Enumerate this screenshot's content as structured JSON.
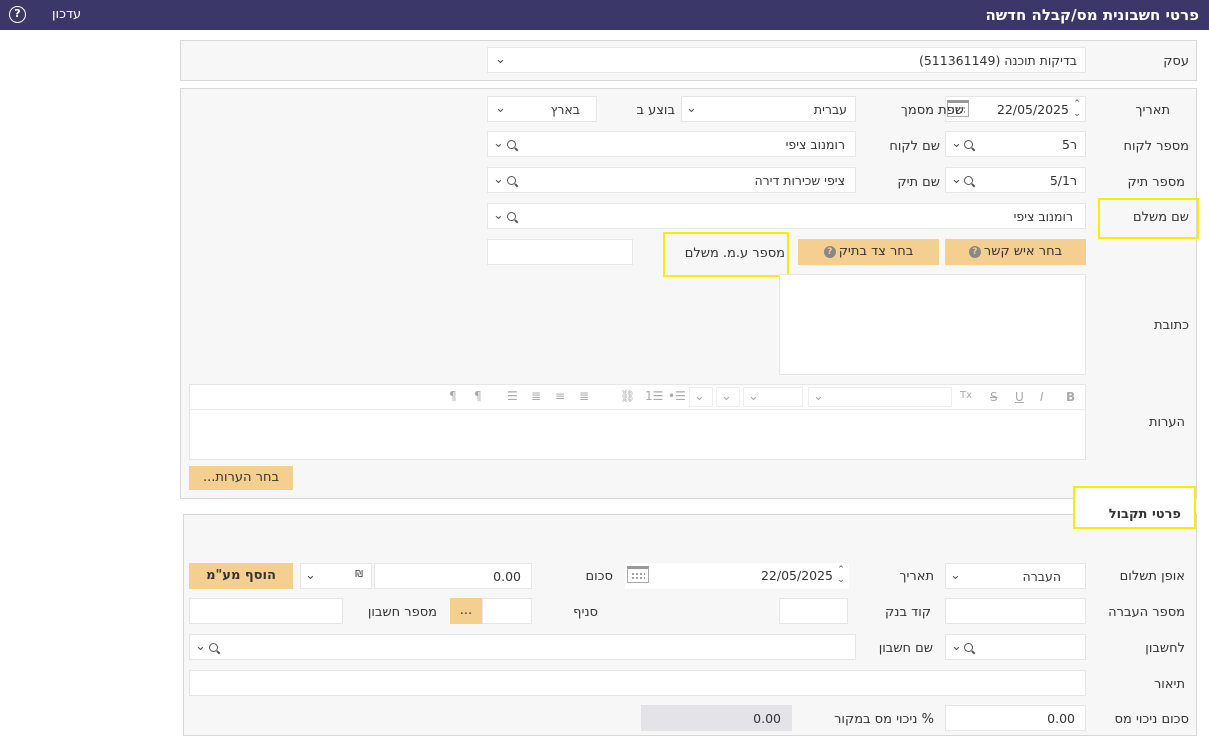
{
  "header": {
    "title": "פרטי חשבונית מס/קבלה חדשה",
    "update_label": "עדכון",
    "help_icon": "?"
  },
  "business": {
    "label": "עסק",
    "value": "בדיקות תוכנה (511361149)"
  },
  "details": {
    "date_label": "תאריך",
    "date_value": "22/05/2025",
    "doc_language_label": "שפת מסמך",
    "doc_language_value": "עברית",
    "performed_in_label": "בוצע ב",
    "performed_in_value": "בארץ",
    "client_number_label": "מספר לקוח",
    "client_number_value": "ר5",
    "client_name_label": "שם לקוח",
    "client_name_value": "רומנוב ציפי",
    "file_number_label": "מספר תיק",
    "file_number_value": "ר5/1",
    "file_name_label": "שם תיק",
    "file_name_value": "ציפי שכירות דירה",
    "payer_name_label": "שם משלם",
    "payer_name_value": "רומנוב ציפי",
    "choose_contact_label": "בחר איש קשר",
    "choose_side_label": "בחר צד בתיק",
    "payer_vat_label": "מספר ע.מ. משלם",
    "payer_vat_value": "",
    "address_label": "כתובת",
    "address_value": "",
    "notes_label": "הערות",
    "notes_value": "",
    "choose_notes_label": "בחר הערות..."
  },
  "editor_toolbar": {
    "bold": "B",
    "italic": "I",
    "underline": "U",
    "strike": "S",
    "clear_format": "Tx"
  },
  "receipt": {
    "section_title": "פרטי תקבול",
    "payment_method_label": "אופן תשלום",
    "payment_method_value": "העברה",
    "date_label": "תאריך",
    "date_value": "22/05/2025",
    "amount_label": "סכום",
    "amount_value": "0.00",
    "add_vat_label": "הוסף מע\"מ",
    "transfer_number_label": "מספר העברה",
    "transfer_number_value": "",
    "bank_code_label": "קוד בנק",
    "bank_code_value": "",
    "branch_label": "סניף",
    "branch_value": "",
    "branch_lookup_label": "...",
    "account_number_label": "מספר חשבון",
    "account_number_value": "",
    "to_account_label": "לחשבון",
    "to_account_value": "",
    "account_name_label": "שם חשבון",
    "account_name_value": "",
    "description_label": "תיאור",
    "description_value": "",
    "withholding_amount_label": "סכום ניכוי מס",
    "withholding_amount_value": "0.00",
    "withholding_percent_label": "% ניכוי מס במקור",
    "withholding_percent_value": "0.00"
  },
  "colors": {
    "header_bg": "#3b3768",
    "button_bg": "#f5cf8f",
    "highlight": "#f6f000"
  }
}
